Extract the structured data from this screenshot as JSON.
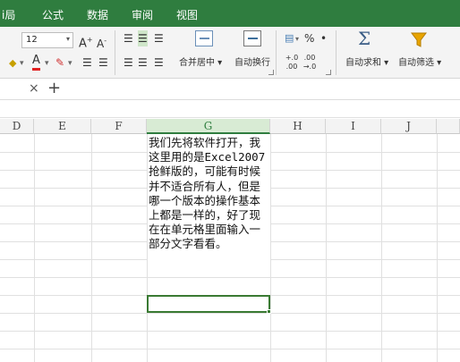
{
  "menu": {
    "items": [
      "i局",
      "公式",
      "数据",
      "审阅",
      "视图"
    ]
  },
  "ribbon": {
    "font_size": "12",
    "grow_font": "A+",
    "shrink_font": "A-",
    "merge_center": "合并居中",
    "wrap_text": "自动换行",
    "percent": "%",
    "comma": "•",
    "dec_inc": "+.0 .00",
    "dec_dec": ".00 →.0",
    "autosum_label": "自动求和",
    "autofilter_label": "自动筛选",
    "sigma": "Σ"
  },
  "tabs": {
    "close": "×",
    "add": "+"
  },
  "grid": {
    "columns": [
      "D",
      "E",
      "F",
      "G",
      "H",
      "I",
      "J"
    ],
    "active_column": "G",
    "cell_g_text": "我们先将软件打开，我这里用的是Excel2007抢鲜版的，可能有时候并不适合所有人，但是哪一个版本的操作基本上都是一样的，好了现在在单元格里面输入一部分文字看看。"
  },
  "colors": {
    "menubar": "#2f7d3f",
    "selection": "#3a7a33",
    "active_header": "#d8ebd4"
  }
}
